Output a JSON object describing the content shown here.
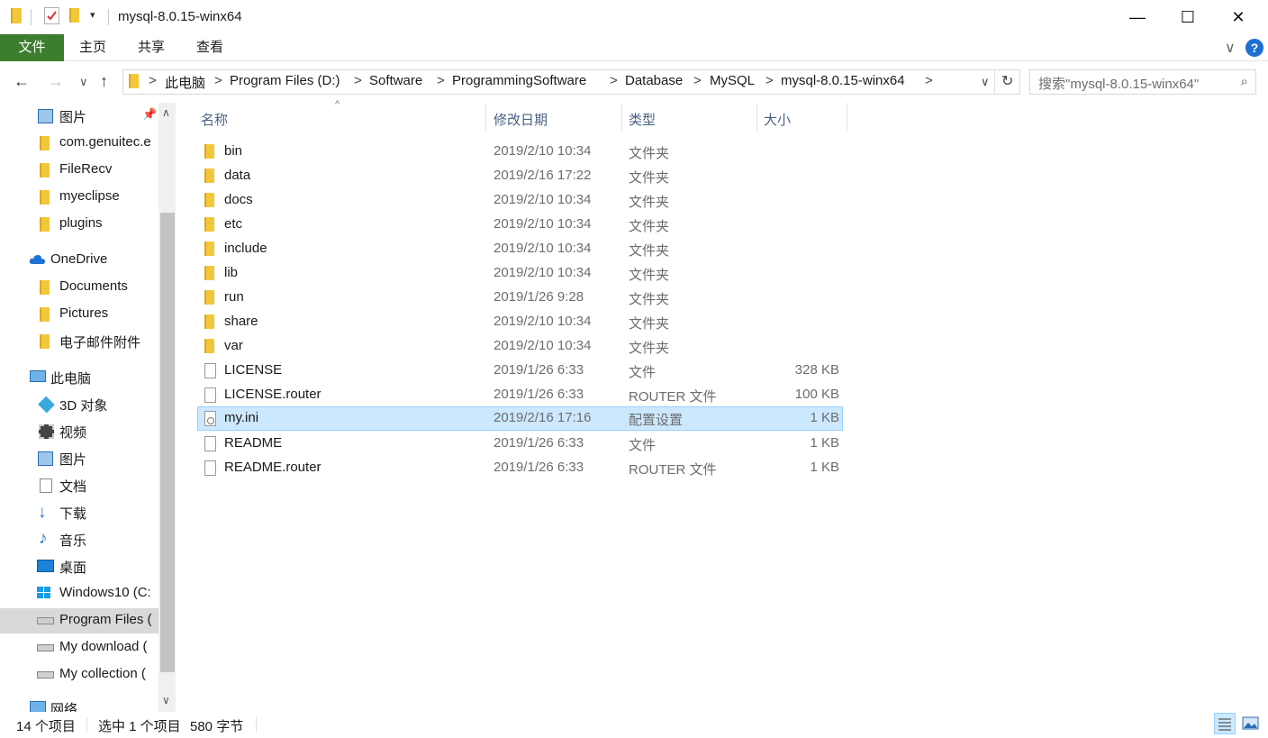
{
  "window": {
    "title": "mysql-8.0.15-winx64",
    "minimize_glyph": "—",
    "maximize_glyph": "☐",
    "close_glyph": "✕"
  },
  "ribbon": {
    "tabs": [
      "文件",
      "主页",
      "共享",
      "查看"
    ],
    "file_tab_color": "#3d7d2e",
    "expand_glyph": "∨",
    "help_glyph": "?"
  },
  "nav": {
    "back_glyph": "←",
    "forward_glyph": "→",
    "recent_glyph": "∨",
    "up_glyph": "↑",
    "breadcrumbs": [
      "此电脑",
      "Program Files (D:)",
      "Software",
      "ProgrammingSoftware",
      "Database",
      "MySQL",
      "mysql-8.0.15-winx64"
    ],
    "crumb_separator": ">",
    "dropdown_glyph": "∨",
    "refresh_glyph": "↻",
    "search_placeholder": "搜索\"mysql-8.0.15-winx64\"",
    "search_icon_glyph": "⌕"
  },
  "sidebar": {
    "pin_glyph": "📌",
    "items": [
      {
        "label": "图片",
        "icon": "pictures-icon",
        "pinned": true
      },
      {
        "label": "com.genuitec.e",
        "icon": "folder-icon"
      },
      {
        "label": "FileRecv",
        "icon": "folder-icon"
      },
      {
        "label": "myeclipse",
        "icon": "folder-icon"
      },
      {
        "label": "plugins",
        "icon": "folder-icon"
      },
      {
        "label": "OneDrive",
        "icon": "onedrive-icon"
      },
      {
        "label": "Documents",
        "icon": "folder-icon"
      },
      {
        "label": "Pictures",
        "icon": "folder-icon"
      },
      {
        "label": "电子邮件附件",
        "icon": "folder-icon"
      },
      {
        "label": "此电脑",
        "icon": "this-pc-icon"
      },
      {
        "label": "3D 对象",
        "icon": "3d-objects-icon"
      },
      {
        "label": "视频",
        "icon": "videos-icon"
      },
      {
        "label": "图片",
        "icon": "pictures-icon"
      },
      {
        "label": "文档",
        "icon": "documents-icon"
      },
      {
        "label": "下载",
        "icon": "downloads-icon"
      },
      {
        "label": "音乐",
        "icon": "music-icon"
      },
      {
        "label": "桌面",
        "icon": "desktop-icon"
      },
      {
        "label": "Windows10 (C:",
        "icon": "windows-drive-icon"
      },
      {
        "label": "Program Files (",
        "icon": "drive-icon",
        "selected": true
      },
      {
        "label": "My download (",
        "icon": "drive-icon"
      },
      {
        "label": "My collection (",
        "icon": "drive-icon"
      },
      {
        "label": "网络",
        "icon": "network-icon"
      }
    ],
    "scroll_up_glyph": "∧",
    "scroll_down_glyph": "∨"
  },
  "columns": {
    "name": "名称",
    "date": "修改日期",
    "type": "类型",
    "size": "大小",
    "sort_glyph": "^"
  },
  "files": [
    {
      "name": "bin",
      "date": "2019/2/10 10:34",
      "type": "文件夹",
      "size": "",
      "icon": "folder-icon"
    },
    {
      "name": "data",
      "date": "2019/2/16 17:22",
      "type": "文件夹",
      "size": "",
      "icon": "folder-icon"
    },
    {
      "name": "docs",
      "date": "2019/2/10 10:34",
      "type": "文件夹",
      "size": "",
      "icon": "folder-icon"
    },
    {
      "name": "etc",
      "date": "2019/2/10 10:34",
      "type": "文件夹",
      "size": "",
      "icon": "folder-icon"
    },
    {
      "name": "include",
      "date": "2019/2/10 10:34",
      "type": "文件夹",
      "size": "",
      "icon": "folder-icon"
    },
    {
      "name": "lib",
      "date": "2019/2/10 10:34",
      "type": "文件夹",
      "size": "",
      "icon": "folder-icon"
    },
    {
      "name": "run",
      "date": "2019/1/26 9:28",
      "type": "文件夹",
      "size": "",
      "icon": "folder-icon"
    },
    {
      "name": "share",
      "date": "2019/2/10 10:34",
      "type": "文件夹",
      "size": "",
      "icon": "folder-icon"
    },
    {
      "name": "var",
      "date": "2019/2/10 10:34",
      "type": "文件夹",
      "size": "",
      "icon": "folder-icon"
    },
    {
      "name": "LICENSE",
      "date": "2019/1/26 6:33",
      "type": "文件",
      "size": "328 KB",
      "icon": "file-icon"
    },
    {
      "name": "LICENSE.router",
      "date": "2019/1/26 6:33",
      "type": "ROUTER 文件",
      "size": "100 KB",
      "icon": "file-icon"
    },
    {
      "name": "my.ini",
      "date": "2019/2/16 17:16",
      "type": "配置设置",
      "size": "1 KB",
      "icon": "ini-file-icon",
      "selected": true
    },
    {
      "name": "README",
      "date": "2019/1/26 6:33",
      "type": "文件",
      "size": "1 KB",
      "icon": "file-icon"
    },
    {
      "name": "README.router",
      "date": "2019/1/26 6:33",
      "type": "ROUTER 文件",
      "size": "1 KB",
      "icon": "file-icon"
    }
  ],
  "status": {
    "item_count": "14 个项目",
    "selection": "选中 1 个项目",
    "selection_size": "580 字节"
  },
  "colors": {
    "selection_bg": "#cce8ff",
    "selection_border": "#99d1ff",
    "folder_yellow": "#f3c73a",
    "header_text": "#4a6184"
  }
}
